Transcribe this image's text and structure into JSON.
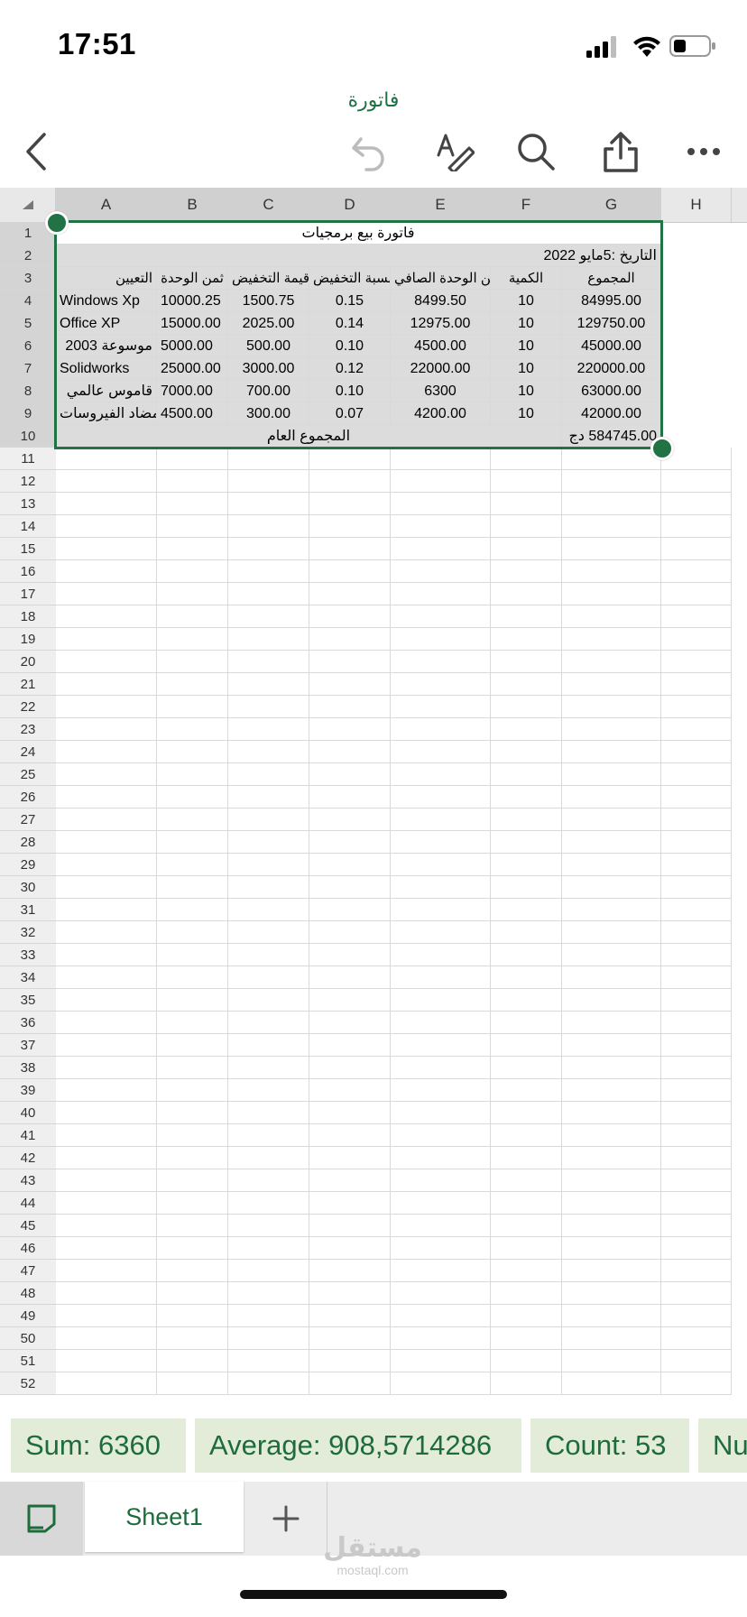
{
  "status_bar": {
    "time": "17:51"
  },
  "app": {
    "title": "فاتورة"
  },
  "colors": {
    "accent": "#217346",
    "chip_bg": "#e3ecd9",
    "chip_text": "#1e6b3c"
  },
  "toolbar": {
    "icons": [
      "back-chevron-icon",
      "undo-icon",
      "draw-pen-icon",
      "search-icon",
      "share-icon",
      "more-icon"
    ]
  },
  "columns": [
    "A",
    "B",
    "C",
    "D",
    "E",
    "F",
    "G",
    "H"
  ],
  "rows_visible": [
    "1",
    "2",
    "3",
    "4",
    "5",
    "6",
    "7",
    "8",
    "9",
    "10",
    "11",
    "12",
    "13",
    "14",
    "15",
    "16",
    "17",
    "18",
    "19",
    "20",
    "21",
    "22",
    "23",
    "24",
    "25",
    "26",
    "27",
    "28",
    "29",
    "30",
    "31",
    "32",
    "33",
    "34",
    "35",
    "36",
    "37",
    "38",
    "39",
    "40",
    "41",
    "42",
    "43",
    "44",
    "45",
    "46",
    "47",
    "48",
    "49",
    "50",
    "51",
    "52"
  ],
  "sheet": {
    "title": "فاتورة بيع برمجيات",
    "date": "التاريخ :5مايو 2022",
    "headers": {
      "A": "التعيين",
      "B": "ثمن الوحدة",
      "C": "قيمة التخفيض",
      "D": "نسبة التخفيض",
      "E": "ثمن الوحدة الصافي",
      "F": "الكمية",
      "G": "المجموع"
    },
    "rows": [
      {
        "A": "Windows Xp",
        "B": "10000.25",
        "C": "1500.75",
        "D": "0.15",
        "E": "8499.50",
        "F": "10",
        "G": "84995.00"
      },
      {
        "A": "Office XP",
        "B": "15000.00",
        "C": "2025.00",
        "D": "0.14",
        "E": "12975.00",
        "F": "10",
        "G": "129750.00"
      },
      {
        "A": "موسوعة 2003",
        "B": "5000.00",
        "C": "500.00",
        "D": "0.10",
        "E": "4500.00",
        "F": "10",
        "G": "45000.00"
      },
      {
        "A": "Solidworks",
        "B": "25000.00",
        "C": "3000.00",
        "D": "0.12",
        "E": "22000.00",
        "F": "10",
        "G": "220000.00"
      },
      {
        "A": "قاموس عالمي",
        "B": "7000.00",
        "C": "700.00",
        "D": "0.10",
        "E": "6300",
        "F": "10",
        "G": "63000.00"
      },
      {
        "A": "مضاد الفيروسات",
        "B": "4500.00",
        "C": "300.00",
        "D": "0.07",
        "E": "4200.00",
        "F": "10",
        "G": "42000.00"
      }
    ],
    "total_label": "المجموع العام",
    "total_value": "584745.00 دج"
  },
  "stats": {
    "sum": "Sum: 6360",
    "average": "Average: 908,5714286",
    "count": "Count: 53",
    "numerical": "Nu"
  },
  "tabs": {
    "sheet1": "Sheet1"
  },
  "watermark": {
    "main": "مستقل",
    "sub": "mostaql.com"
  }
}
